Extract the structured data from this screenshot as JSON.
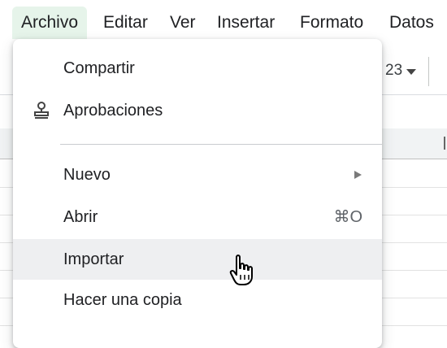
{
  "menubar": {
    "items": [
      {
        "label": "Archivo",
        "active": true
      },
      {
        "label": "Editar"
      },
      {
        "label": "Ver"
      },
      {
        "label": "Insertar"
      },
      {
        "label": "Formato"
      },
      {
        "label": "Datos"
      }
    ]
  },
  "toolbar": {
    "zoom_text": "23"
  },
  "dropdown": {
    "items": [
      {
        "label": "Compartir"
      },
      {
        "label": "Aprobaciones",
        "icon": "stamp-icon"
      },
      {
        "label": "Nuevo",
        "has_submenu": true
      },
      {
        "label": "Abrir",
        "shortcut": "⌘O"
      },
      {
        "label": "Importar",
        "hovered": true
      },
      {
        "label": "Hacer una copia"
      }
    ]
  },
  "colors": {
    "active_menu_bg": "#e6f4ea",
    "hover_row_bg": "#eeeff1",
    "text": "#202124",
    "muted_text": "#5f6368"
  }
}
